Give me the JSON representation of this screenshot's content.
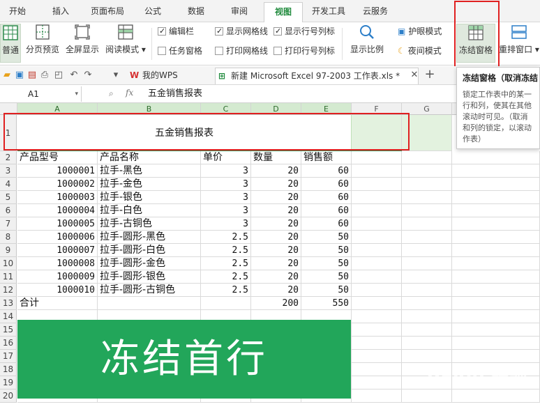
{
  "menu_tabs": [
    "开始",
    "插入",
    "页面布局",
    "公式",
    "数据",
    "审阅",
    "视图",
    "开发工具",
    "云服务"
  ],
  "active_tab": "视图",
  "ribbon": {
    "normal": "普通",
    "page_break": "分页预览",
    "fullscreen": "全屏显示",
    "reading_mode": "阅读模式",
    "check_formula_bar": "编辑栏",
    "check_task_pane": "任务窗格",
    "check_gridlines": "显示网格线",
    "check_print_gridlines": "打印网格线",
    "check_headings": "显示行号列标",
    "check_print_headings": "打印行号列标",
    "zoom": "显示比例",
    "eye_protect": "护眼模式",
    "night_mode": "夜间模式",
    "freeze_panes": "冻结窗格",
    "arrange_windows": "重排窗口"
  },
  "doc_tabs": [
    "我的WPS",
    "新建 Microsoft Excel 97-2003 工作表.xls *"
  ],
  "name_box": "A1",
  "fx_label": "fx",
  "formula_value": "五金销售报表",
  "columns": [
    "A",
    "B",
    "C",
    "D",
    "E",
    "F",
    "G"
  ],
  "row_numbers": [
    "1",
    "2",
    "3",
    "4",
    "5",
    "6",
    "7",
    "8",
    "9",
    "10",
    "11",
    "12",
    "13",
    "14",
    "15",
    "16",
    "17",
    "18",
    "19",
    "20"
  ],
  "title_cell": "五金销售报表",
  "headers": [
    "产品型号",
    "产品名称",
    "单价",
    "数量",
    "销售额"
  ],
  "rows": [
    [
      "1000001",
      "拉手-黑色",
      "3",
      "20",
      "60"
    ],
    [
      "1000002",
      "拉手-金色",
      "3",
      "20",
      "60"
    ],
    [
      "1000003",
      "拉手-银色",
      "3",
      "20",
      "60"
    ],
    [
      "1000004",
      "拉手-白色",
      "3",
      "20",
      "60"
    ],
    [
      "1000005",
      "拉手-古铜色",
      "3",
      "20",
      "60"
    ],
    [
      "1000006",
      "拉手-圆形-黑色",
      "2.5",
      "20",
      "50"
    ],
    [
      "1000007",
      "拉手-圆形-白色",
      "2.5",
      "20",
      "50"
    ],
    [
      "1000008",
      "拉手-圆形-金色",
      "2.5",
      "20",
      "50"
    ],
    [
      "1000009",
      "拉手-圆形-银色",
      "2.5",
      "20",
      "50"
    ],
    [
      "1000010",
      "拉手-圆形-古铜色",
      "2.5",
      "20",
      "50"
    ]
  ],
  "total_row": [
    "合计",
    "",
    "",
    "200",
    "550"
  ],
  "banner_text": "冻结首行",
  "tooltip": {
    "title": "冻结窗格（取消冻结",
    "body": "锁定工作表中的某一行和列，使其在其他滚动时可见。（取消和列的锁定，以滚动作表）"
  },
  "watermark": "Baidu 经验",
  "watermark_url": "jingyan.baidu.com",
  "colors": {
    "accent": "#1f8a3c",
    "banner": "#22a65a",
    "highlight": "#e02020"
  }
}
